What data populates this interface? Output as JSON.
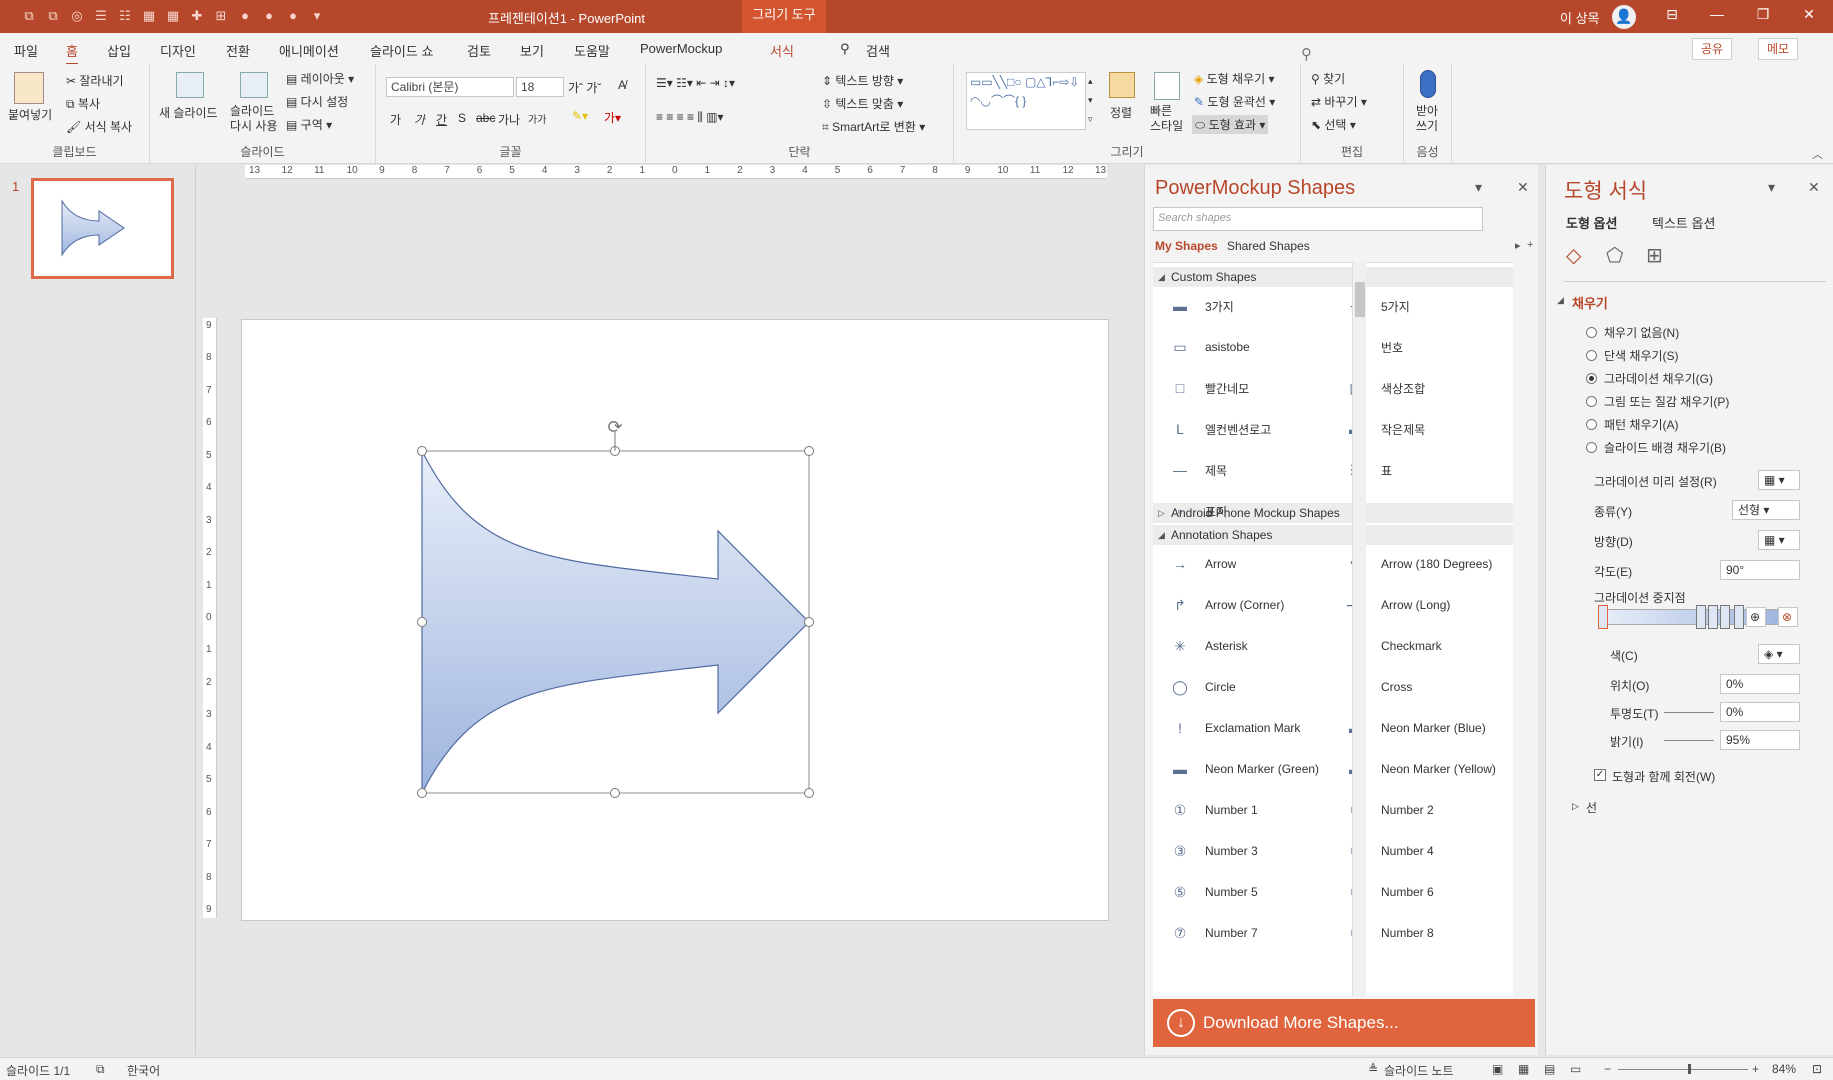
{
  "titlebar": {
    "title": "프레젠테이션1  -  PowerPoint",
    "tool_tab": "그리기 도구",
    "user": "이 상목",
    "avatar": "👤",
    "qat_icons": [
      "undo-icon",
      "redo-icon",
      "shape-icon",
      "bullets-icon",
      "numbers-icon",
      "table-icon",
      "grid-icon",
      "plus-icon",
      "text-icon",
      "merge-icon",
      "intersect-icon",
      "combine-icon",
      "customize-icon"
    ]
  },
  "tabs": {
    "file": "파일",
    "home": "홈",
    "insert": "삽입",
    "design": "디자인",
    "transitions": "전환",
    "animations": "애니메이션",
    "slideshow": "슬라이드 쇼",
    "review": "검토",
    "view": "보기",
    "help": "도움말",
    "powermockup": "PowerMockup",
    "format": "서식",
    "search": "검색",
    "share": "공유",
    "memo": "메모"
  },
  "ribbon": {
    "clipboard": {
      "paste": "붙여넣기",
      "cut": "잘라내기",
      "copy": "복사",
      "format_painter": "서식 복사",
      "label": "클립보드"
    },
    "slides": {
      "new_slide": "새 슬라이드",
      "reuse": "슬라이드\n다시 사용",
      "layout": "레이아웃",
      "reset": "다시 설정",
      "section": "구역",
      "label": "슬라이드"
    },
    "font": {
      "name": "Calibri (본문)",
      "size": "18",
      "label": "글꼴",
      "buttons": [
        "가",
        "가",
        "간",
        "S",
        "abc",
        "가나",
        "가가"
      ]
    },
    "paragraph": {
      "text_direction": "텍스트 방향",
      "align_text": "텍스트 맞춤",
      "smartart": "SmartArt로 변환",
      "label": "단락"
    },
    "drawing": {
      "arrange": "정렬",
      "quick_styles": "빠른\n스타일",
      "fill": "도형 채우기",
      "outline": "도형 윤곽선",
      "effects": "도형 효과",
      "label": "그리기"
    },
    "editing": {
      "find": "찾기",
      "replace": "바꾸기",
      "select": "선택",
      "label": "편집"
    },
    "voice": {
      "dictate": "받아\n쓰기",
      "label": "음성"
    }
  },
  "thumbnails": {
    "number": "1"
  },
  "rulers": {
    "h_ticks": [
      "13",
      "12",
      "11",
      "10",
      "9",
      "8",
      "7",
      "6",
      "5",
      "4",
      "3",
      "2",
      "1",
      "0",
      "1",
      "2",
      "3",
      "4",
      "5",
      "6",
      "7",
      "8",
      "9",
      "10",
      "11",
      "12",
      "13"
    ],
    "v_ticks": [
      "9",
      "8",
      "7",
      "6",
      "5",
      "4",
      "3",
      "2",
      "1",
      "0",
      "1",
      "2",
      "3",
      "4",
      "5",
      "6",
      "7",
      "8",
      "9"
    ]
  },
  "powermockup": {
    "title": "PowerMockup Shapes",
    "search_placeholder": "Search shapes",
    "my_shapes": "My Shapes",
    "shared_shapes": "Shared Shapes",
    "sections": {
      "custom": "Custom Shapes",
      "android": "Android Phone Mockup Shapes",
      "annotation": "Annotation Shapes"
    },
    "custom_items": [
      {
        "label": "3가지",
        "icon": "▬"
      },
      {
        "label": "5가지",
        "icon": "⊸"
      },
      {
        "label": "asistobe",
        "icon": "▭"
      },
      {
        "label": "번호",
        "icon": "1"
      },
      {
        "label": "빨간네모",
        "icon": "□"
      },
      {
        "label": "색상조합",
        "icon": "▦"
      },
      {
        "label": "엘컨벤션로고",
        "icon": "L"
      },
      {
        "label": "작은제목",
        "icon": "▬"
      },
      {
        "label": "제목",
        "icon": "—"
      },
      {
        "label": "표",
        "icon": "☰"
      },
      {
        "label": "표지",
        "icon": "▫"
      }
    ],
    "annotation_items": [
      {
        "label": "Arrow",
        "icon": "→"
      },
      {
        "label": "Arrow (180 Degrees)",
        "icon": "↷"
      },
      {
        "label": "Arrow (Corner)",
        "icon": "↱"
      },
      {
        "label": "Arrow (Long)",
        "icon": "⟶"
      },
      {
        "label": "Asterisk",
        "icon": "✳"
      },
      {
        "label": "Checkmark",
        "icon": "✓"
      },
      {
        "label": "Circle",
        "icon": "◯"
      },
      {
        "label": "Cross",
        "icon": "✕"
      },
      {
        "label": "Exclamation Mark",
        "icon": "!"
      },
      {
        "label": "Neon Marker (Blue)",
        "icon": "▬"
      },
      {
        "label": "Neon Marker (Green)",
        "icon": "▬"
      },
      {
        "label": "Neon Marker (Yellow)",
        "icon": "▬"
      },
      {
        "label": "Number 1",
        "icon": "①"
      },
      {
        "label": "Number 2",
        "icon": "②"
      },
      {
        "label": "Number 3",
        "icon": "③"
      },
      {
        "label": "Number 4",
        "icon": "④"
      },
      {
        "label": "Number 5",
        "icon": "⑤"
      },
      {
        "label": "Number 6",
        "icon": "⑥"
      },
      {
        "label": "Number 7",
        "icon": "⑦"
      },
      {
        "label": "Number 8",
        "icon": "⑧"
      }
    ],
    "download": "Download More Shapes..."
  },
  "format_pane": {
    "title": "도형 서식",
    "tab_shape": "도형 옵션",
    "tab_text": "텍스트 옵션",
    "section_fill": "채우기",
    "fill_options": [
      {
        "label": "채우기 없음(N)",
        "checked": false
      },
      {
        "label": "단색 채우기(S)",
        "checked": false
      },
      {
        "label": "그라데이션 채우기(G)",
        "checked": true
      },
      {
        "label": "그림 또는 질감 채우기(P)",
        "checked": false
      },
      {
        "label": "패턴 채우기(A)",
        "checked": false
      },
      {
        "label": "슬라이드 배경 채우기(B)",
        "checked": false
      }
    ],
    "preset_label": "그라데이션 미리 설정(R)",
    "type_label": "종류(Y)",
    "type_value": "선형",
    "direction_label": "방향(D)",
    "angle_label": "각도(E)",
    "angle_value": "90°",
    "stops_label": "그라데이션 중지점",
    "color_label": "색(C)",
    "position_label": "위치(O)",
    "position_value": "0%",
    "transparency_label": "투명도(T)",
    "transparency_value": "0%",
    "brightness_label": "밝기(I)",
    "brightness_value": "95%",
    "rotate_label": "도형과 함께 회전(W)",
    "line_section": "선"
  },
  "statusbar": {
    "slide": "슬라이드 1/1",
    "language": "한국어",
    "notes": "슬라이드 노트",
    "zoom": "84%"
  },
  "colors": {
    "accent": "#b7472a",
    "shape_fill_top": "#e8eef9",
    "shape_fill_bottom": "#9fb5de",
    "shape_stroke": "#4f6aa0"
  }
}
